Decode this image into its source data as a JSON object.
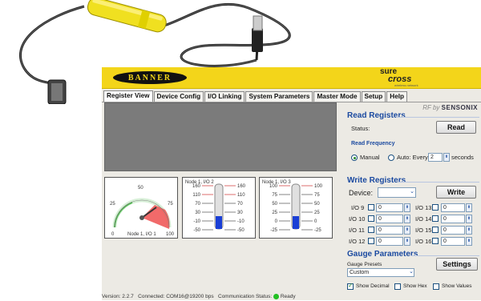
{
  "app": {
    "brand_logo": "BANNER",
    "product_logo_top": "sure",
    "product_logo_main": "cross",
    "product_logo_tag": "wireless network",
    "rfby_prefix": "RF by",
    "rfby_brand": "SENSONIX"
  },
  "tabs": [
    {
      "label": "Register View",
      "active": true
    },
    {
      "label": "Device Config",
      "active": false
    },
    {
      "label": "I/O Linking",
      "active": false
    },
    {
      "label": "System Parameters",
      "active": false
    },
    {
      "label": "Master Mode",
      "active": false
    },
    {
      "label": "Setup",
      "active": false
    },
    {
      "label": "Help",
      "active": false
    }
  ],
  "gauges": {
    "dial": {
      "label": "Node 1, I/O 1",
      "ticks": [
        "0",
        "25",
        "50",
        "75",
        "100"
      ],
      "value": 63
    },
    "therm1": {
      "label": "Node 1, I/O 2",
      "left_ticks": [
        "160",
        "110",
        "70",
        "30",
        "-10",
        "-50"
      ],
      "right_ticks": [
        "160",
        "110",
        "70",
        "30",
        "-10",
        "-50"
      ],
      "level": 0.25
    },
    "therm2": {
      "label": "Node 1, I/O 3",
      "left_ticks": [
        "100",
        "75",
        "50",
        "25",
        "0",
        "-25"
      ],
      "right_ticks": [
        "100",
        "75",
        "50",
        "25",
        "0",
        "-25"
      ],
      "level": 0.25
    }
  },
  "read": {
    "title": "Read Registers",
    "status_label": "Status:",
    "read_button": "Read",
    "freq_title": "Read Frequency",
    "manual": "Manual",
    "auto": "Auto: Every",
    "seconds_value": "2",
    "seconds": "seconds"
  },
  "write": {
    "title": "Write Registers",
    "device_label": "Device:",
    "device_value": "",
    "write_button": "Write",
    "io": [
      {
        "label": "I/O 9",
        "value": "0"
      },
      {
        "label": "I/O 13",
        "value": "0"
      },
      {
        "label": "I/O 10",
        "value": "0"
      },
      {
        "label": "I/O 14",
        "value": "0"
      },
      {
        "label": "I/O 11",
        "value": "0"
      },
      {
        "label": "I/O 15",
        "value": "0"
      },
      {
        "label": "I/O 12",
        "value": "0"
      },
      {
        "label": "I/O 16",
        "value": "0"
      }
    ]
  },
  "gauge_params": {
    "title": "Gauge Parameters",
    "presets_label": "Gauge Presets",
    "preset_value": "Custom",
    "settings_button": "Settings",
    "show_decimal": "Show Decimal",
    "show_hex": "Show Hex",
    "show_values": "Show Values"
  },
  "status": {
    "version": "Version: 2.2.7",
    "connected": "Connected: COM16@19200 bps",
    "comm": "Communication Status:",
    "ready": "Ready"
  },
  "colors": {
    "accent": "#1b4aa0",
    "header": "#f3d51a",
    "ready": "#22c022"
  }
}
